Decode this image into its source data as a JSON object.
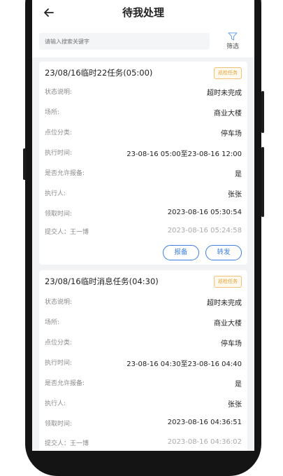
{
  "header": {
    "title": "待我处理"
  },
  "search": {
    "placeholder": "请输入搜索关键字",
    "filter_label": "筛选"
  },
  "tasks": [
    {
      "title": "23/08/16临时22任务(05:00)",
      "tag": "巡检任务",
      "status_label": "状态说明:",
      "status": "超时未完成",
      "place_label": "场所:",
      "place": "商业大楼",
      "category_label": "点位分类:",
      "category": "停车场",
      "exec_time_label": "执行时间:",
      "exec_time": "23-08-16 05:00至23-08-16 12:00",
      "allow_report_label": "是否允许报备:",
      "allow_report": "是",
      "executor_label": "执行人:",
      "executor": "张张",
      "receive_time_label": "领取时间:",
      "receive_time": "2023-08-16 05:30:54",
      "submitter_label": "提交人：王一博",
      "submit_time": "2023-08-16 05:24:58",
      "actions": [
        "报备",
        "转发"
      ]
    },
    {
      "title": "23/08/16临时消息任务(04:30)",
      "tag": "巡检任务",
      "status_label": "状态说明:",
      "status": "超时未完成",
      "place_label": "场所:",
      "place": "商业大楼",
      "category_label": "点位分类:",
      "category": "停车场",
      "exec_time_label": "执行时间:",
      "exec_time": "23-08-16 04:30至23-08-16 04:40",
      "allow_report_label": "是否允许报备:",
      "allow_report": "是",
      "executor_label": "执行人:",
      "executor": "张张",
      "receive_time_label": "领取时间:",
      "receive_time": "2023-08-16 04:36:51",
      "submitter_label": "提交人：王一博",
      "submit_time": "2023-08-16 04:36:02"
    }
  ]
}
